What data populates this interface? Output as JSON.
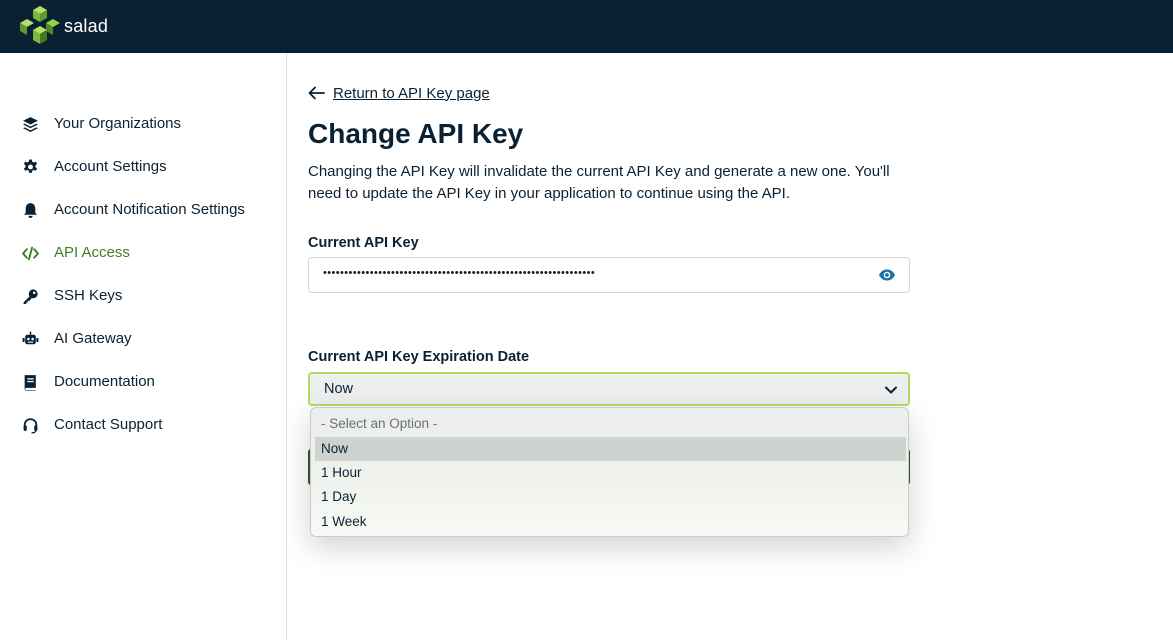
{
  "app": {
    "brand": "salad",
    "brand_color": "#0a2133",
    "accent_color": "#3e7d26",
    "logo_color": "#9bd24a"
  },
  "sidebar": {
    "items": [
      {
        "label": "Your Organizations",
        "icon": "layers-icon",
        "active": false
      },
      {
        "label": "Account Settings",
        "icon": "gear-icon",
        "active": false
      },
      {
        "label": "Account Notification Settings",
        "icon": "bell-icon",
        "active": false
      },
      {
        "label": "API Access",
        "icon": "code-icon",
        "active": true
      },
      {
        "label": "SSH Keys",
        "icon": "key-icon",
        "active": false
      },
      {
        "label": "AI Gateway",
        "icon": "robot-icon",
        "active": false
      },
      {
        "label": "Documentation",
        "icon": "book-icon",
        "active": false
      },
      {
        "label": "Contact Support",
        "icon": "headset-icon",
        "active": false
      }
    ]
  },
  "main": {
    "back_link": "Return to API Key page",
    "title": "Change API Key",
    "description": "Changing the API Key will invalidate the current API Key and generate a new one. You'll need to update the API Key in your application to continue using the API.",
    "current_key_label": "Current API Key",
    "current_key_masked": "••••••••••••••••••••••••••••••••••••••••••••••••••••••••••••••••",
    "expiration_label": "Current API Key Expiration Date",
    "expiration_value": "Now",
    "expiration_options": [
      {
        "label": "- Select an Option -",
        "placeholder": true,
        "selected": false
      },
      {
        "label": "Now",
        "placeholder": false,
        "selected": true
      },
      {
        "label": "1 Hour",
        "placeholder": false,
        "selected": false
      },
      {
        "label": "1 Day",
        "placeholder": false,
        "selected": false
      },
      {
        "label": "1 Week",
        "placeholder": false,
        "selected": false
      }
    ]
  }
}
